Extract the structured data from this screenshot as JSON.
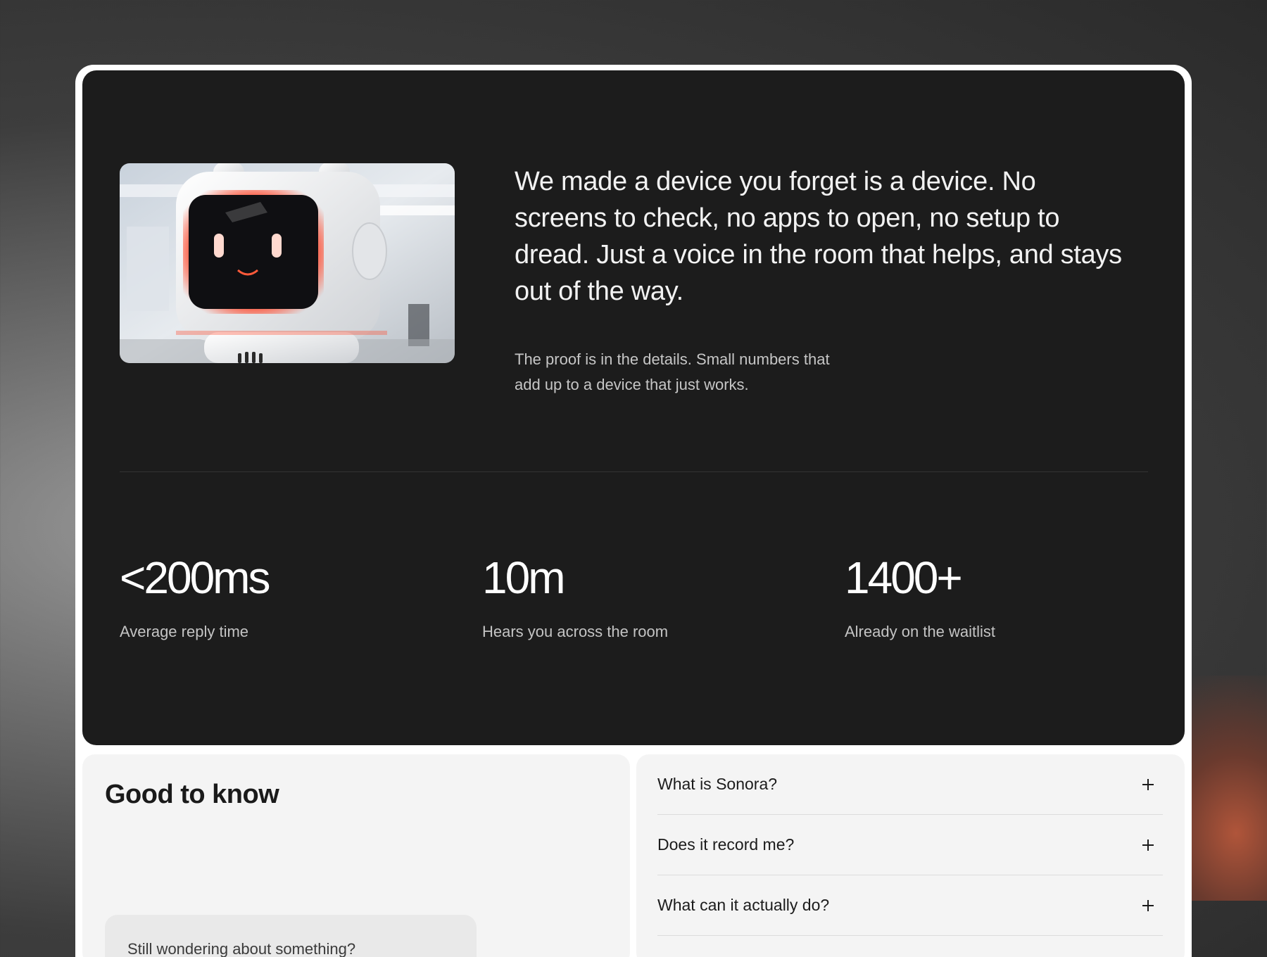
{
  "hero": {
    "headline": "We made a device you forget is a device. No screens to check, no apps to open, no setup to dread. Just a voice in the room that helps, and stays out of the way.",
    "subtext": "The proof is in the details. Small numbers that add up to a device that just works."
  },
  "stats": [
    {
      "value": "<200ms",
      "label": "Average reply time"
    },
    {
      "value": "10m",
      "label": "Hears you across the room"
    },
    {
      "value": "1400+",
      "label": "Already on the waitlist"
    }
  ],
  "faq": {
    "title": "Good to know",
    "prompt": "Still wondering about something?",
    "items": [
      {
        "question": "What is Sonora?"
      },
      {
        "question": "Does it record me?"
      },
      {
        "question": "What can it actually do?"
      }
    ]
  },
  "colors": {
    "dark_card": "#1c1c1c",
    "light_card": "#f4f4f4",
    "robot_glow": "#ff4a2e"
  },
  "icons": [
    "robot-image",
    "plus-icon"
  ]
}
